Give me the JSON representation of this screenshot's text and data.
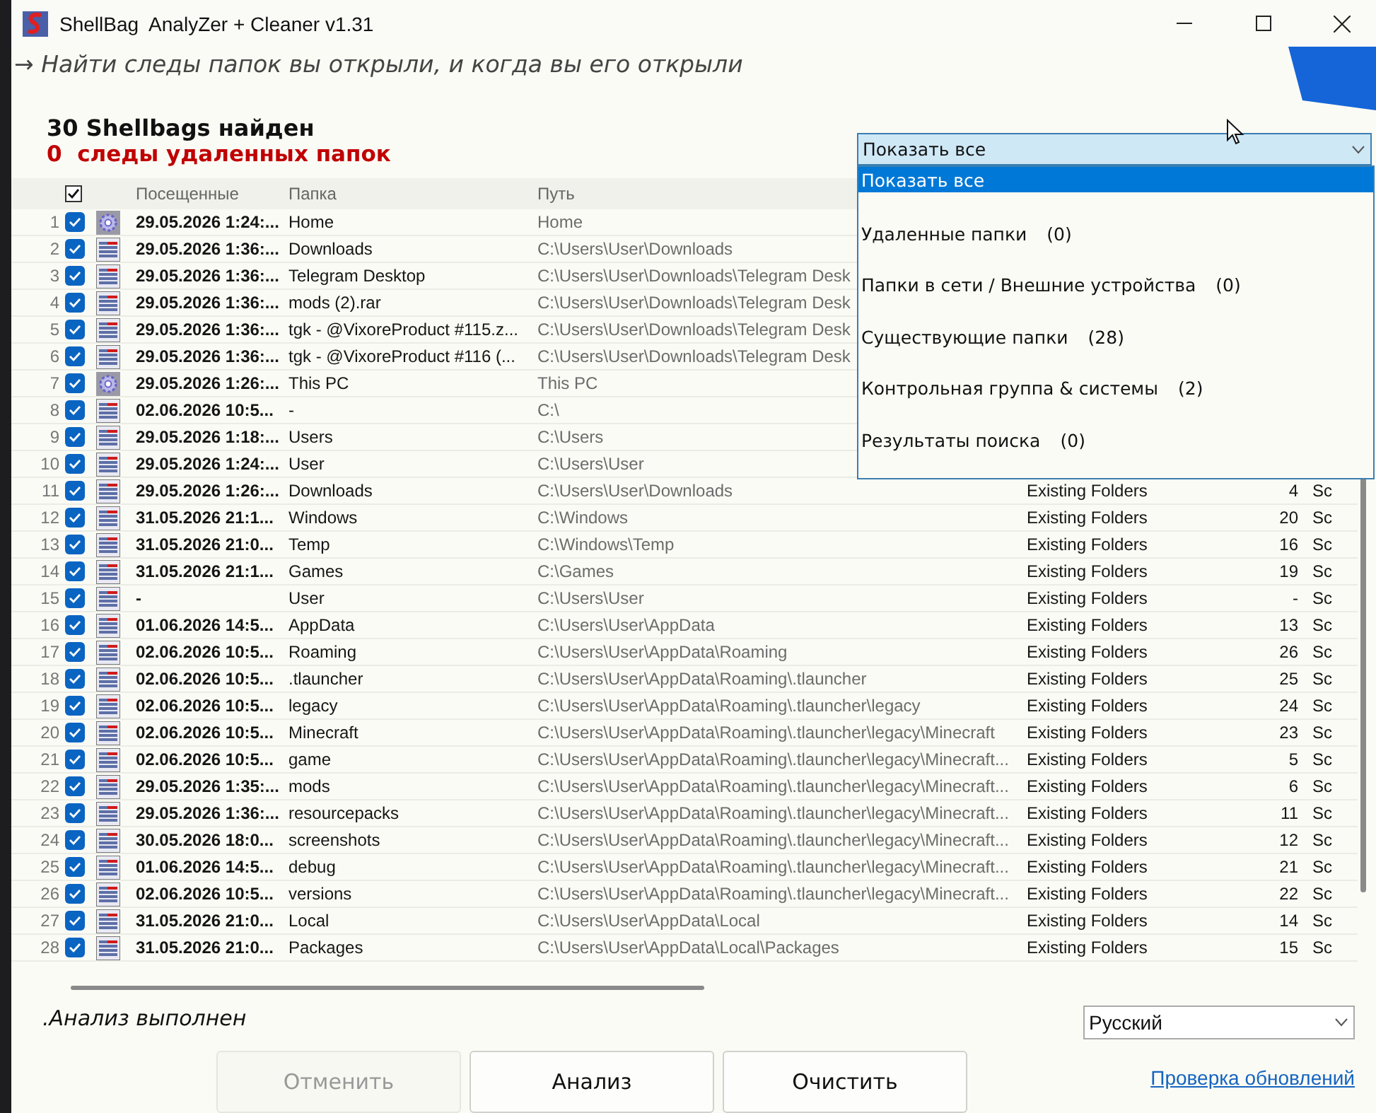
{
  "window": {
    "title": "ShellBag  AnalyZer + Cleaner v1.31"
  },
  "tagline": "→ Найти следы папок вы открыли, и когда вы его открыли",
  "summary": {
    "found": "30 Shellbags найден",
    "deleted_count": "0",
    "deleted_label": "следы удаленных папок"
  },
  "filter": {
    "value": "Показать все",
    "expanded": true,
    "options": [
      {
        "label": "Показать все",
        "selected": true
      },
      {
        "label": "Удаленные папки",
        "count": "(0)",
        "selected": false
      },
      {
        "label": "Папки в сети / Внешние устройства",
        "count": "(0)",
        "selected": false
      },
      {
        "label": "Существующие папки",
        "count": "(28)",
        "selected": false
      },
      {
        "label": "Контрольная группа & системы",
        "count": "(2)",
        "selected": false
      },
      {
        "label": "Результаты поиска",
        "count": "(0)",
        "selected": false
      }
    ]
  },
  "table": {
    "header_checked": true,
    "columns": [
      "Посещенные",
      "Папка",
      "Путь"
    ],
    "rows": [
      {
        "n": "1",
        "checked": true,
        "kind": "gear",
        "visited": "29.05.2026 1:24:...",
        "folder": "Home",
        "path": "Home"
      },
      {
        "n": "2",
        "checked": true,
        "kind": "folder",
        "visited": "29.05.2026 1:36:...",
        "folder": "Downloads",
        "path": "C:\\Users\\User\\Downloads"
      },
      {
        "n": "3",
        "checked": true,
        "kind": "folder",
        "visited": "29.05.2026 1:36:...",
        "folder": "Telegram Desktop",
        "path": "C:\\Users\\User\\Downloads\\Telegram Desk"
      },
      {
        "n": "4",
        "checked": true,
        "kind": "folder",
        "visited": "29.05.2026 1:36:...",
        "folder": "mods (2).rar",
        "path": "C:\\Users\\User\\Downloads\\Telegram Desk"
      },
      {
        "n": "5",
        "checked": true,
        "kind": "folder",
        "visited": "29.05.2026 1:36:...",
        "folder": "tgk - @VixoreProduct #115.z...",
        "path": "C:\\Users\\User\\Downloads\\Telegram Desk"
      },
      {
        "n": "6",
        "checked": true,
        "kind": "folder",
        "visited": "29.05.2026 1:36:...",
        "folder": "tgk - @VixoreProduct #116 (...",
        "path": "C:\\Users\\User\\Downloads\\Telegram Desk"
      },
      {
        "n": "7",
        "checked": true,
        "kind": "gear",
        "visited": "29.05.2026 1:26:...",
        "folder": "This PC",
        "path": "This PC"
      },
      {
        "n": "8",
        "checked": true,
        "kind": "folder",
        "visited": "02.06.2026 10:5...",
        "folder": "-",
        "path": "C:\\"
      },
      {
        "n": "9",
        "checked": true,
        "kind": "folder",
        "visited": "29.05.2026 1:18:...",
        "folder": "Users",
        "path": "C:\\Users"
      },
      {
        "n": "10",
        "checked": true,
        "kind": "folder",
        "visited": "29.05.2026 1:24:...",
        "folder": "User",
        "path": "C:\\Users\\User"
      },
      {
        "n": "11",
        "checked": true,
        "kind": "folder",
        "visited": "29.05.2026 1:26:...",
        "folder": "Downloads",
        "path": "C:\\Users\\User\\Downloads",
        "category": "Existing Folders",
        "count": "4",
        "column_6": "Sc"
      },
      {
        "n": "12",
        "checked": true,
        "kind": "folder",
        "visited": "31.05.2026 21:1...",
        "folder": "Windows",
        "path": "C:\\Windows",
        "category": "Existing Folders",
        "count": "20",
        "column_6": "Sc"
      },
      {
        "n": "13",
        "checked": true,
        "kind": "folder",
        "visited": "31.05.2026 21:0...",
        "folder": "Temp",
        "path": "C:\\Windows\\Temp",
        "category": "Existing Folders",
        "count": "16",
        "column_6": "Sc"
      },
      {
        "n": "14",
        "checked": true,
        "kind": "folder",
        "visited": "31.05.2026 21:1...",
        "folder": "Games",
        "path": "C:\\Games",
        "category": "Existing Folders",
        "count": "19",
        "column_6": "Sc"
      },
      {
        "n": "15",
        "checked": true,
        "kind": "folder",
        "visited": "-",
        "folder": "User",
        "path": "C:\\Users\\User",
        "category": "Existing Folders",
        "count": "-",
        "column_6": "Sc"
      },
      {
        "n": "16",
        "checked": true,
        "kind": "folder",
        "visited": "01.06.2026 14:5...",
        "folder": "AppData",
        "path": "C:\\Users\\User\\AppData",
        "category": "Existing Folders",
        "count": "13",
        "column_6": "Sc"
      },
      {
        "n": "17",
        "checked": true,
        "kind": "folder",
        "visited": "02.06.2026 10:5...",
        "folder": "Roaming",
        "path": "C:\\Users\\User\\AppData\\Roaming",
        "category": "Existing Folders",
        "count": "26",
        "column_6": "Sc"
      },
      {
        "n": "18",
        "checked": true,
        "kind": "folder",
        "visited": "02.06.2026 10:5...",
        "folder": ".tlauncher",
        "path": "C:\\Users\\User\\AppData\\Roaming\\.tlauncher",
        "category": "Existing Folders",
        "count": "25",
        "column_6": "Sc"
      },
      {
        "n": "19",
        "checked": true,
        "kind": "folder",
        "visited": "02.06.2026 10:5...",
        "folder": "legacy",
        "path": "C:\\Users\\User\\AppData\\Roaming\\.tlauncher\\legacy",
        "category": "Existing Folders",
        "count": "24",
        "column_6": "Sc"
      },
      {
        "n": "20",
        "checked": true,
        "kind": "folder",
        "visited": "02.06.2026 10:5...",
        "folder": "Minecraft",
        "path": "C:\\Users\\User\\AppData\\Roaming\\.tlauncher\\legacy\\Minecraft",
        "category": "Existing Folders",
        "count": "23",
        "column_6": "Sc"
      },
      {
        "n": "21",
        "checked": true,
        "kind": "folder",
        "visited": "02.06.2026 10:5...",
        "folder": "game",
        "path": "C:\\Users\\User\\AppData\\Roaming\\.tlauncher\\legacy\\Minecraft...",
        "category": "Existing Folders",
        "count": "5",
        "column_6": "Sc"
      },
      {
        "n": "22",
        "checked": true,
        "kind": "folder",
        "visited": "29.05.2026 1:35:...",
        "folder": "mods",
        "path": "C:\\Users\\User\\AppData\\Roaming\\.tlauncher\\legacy\\Minecraft...",
        "category": "Existing Folders",
        "count": "6",
        "column_6": "Sc"
      },
      {
        "n": "23",
        "checked": true,
        "kind": "folder",
        "visited": "29.05.2026 1:36:...",
        "folder": "resourcepacks",
        "path": "C:\\Users\\User\\AppData\\Roaming\\.tlauncher\\legacy\\Minecraft...",
        "category": "Existing Folders",
        "count": "11",
        "column_6": "Sc"
      },
      {
        "n": "24",
        "checked": true,
        "kind": "folder",
        "visited": "30.05.2026 18:0...",
        "folder": "screenshots",
        "path": "C:\\Users\\User\\AppData\\Roaming\\.tlauncher\\legacy\\Minecraft...",
        "category": "Existing Folders",
        "count": "12",
        "column_6": "Sc"
      },
      {
        "n": "25",
        "checked": true,
        "kind": "folder",
        "visited": "01.06.2026 14:5...",
        "folder": "debug",
        "path": "C:\\Users\\User\\AppData\\Roaming\\.tlauncher\\legacy\\Minecraft...",
        "category": "Existing Folders",
        "count": "21",
        "column_6": "Sc"
      },
      {
        "n": "26",
        "checked": true,
        "kind": "folder",
        "visited": "02.06.2026 10:5...",
        "folder": "versions",
        "path": "C:\\Users\\User\\AppData\\Roaming\\.tlauncher\\legacy\\Minecraft...",
        "category": "Existing Folders",
        "count": "22",
        "column_6": "Sc"
      },
      {
        "n": "27",
        "checked": true,
        "kind": "folder",
        "visited": "31.05.2026 21:0...",
        "folder": "Local",
        "path": "C:\\Users\\User\\AppData\\Local",
        "category": "Existing Folders",
        "count": "14",
        "column_6": "Sc"
      },
      {
        "n": "28",
        "checked": true,
        "kind": "folder",
        "visited": "31.05.2026 21:0...",
        "folder": "Packages",
        "path": "C:\\Users\\User\\AppData\\Local\\Packages",
        "category": "Existing Folders",
        "count": "15",
        "column_6": "Sc"
      }
    ]
  },
  "status": ".Анализ выполнен",
  "language": "Русский",
  "buttons": [
    {
      "label": "Отменить",
      "disabled": true
    },
    {
      "label": "Анализ",
      "disabled": false
    },
    {
      "label": "Очистить",
      "disabled": false
    }
  ],
  "link": "Проверка обновлений"
}
